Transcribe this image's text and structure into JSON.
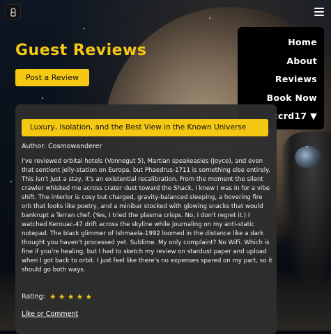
{
  "header": {
    "logo_icon": "astronaut-logo-icon",
    "menu_icon": "hamburger-menu-icon"
  },
  "menu": {
    "items": [
      "Home",
      "About",
      "Reviews",
      "Book Now",
      "ccrd17 ▼"
    ]
  },
  "page": {
    "title": "Guest Reviews",
    "post_button": "Post a Review"
  },
  "review": {
    "title": "Luxury, Isolation, and the Best View in the Known Universe",
    "author": "Author: Cosmowanderer",
    "body": "I've reviewed orbital hotels (Vonnegut 5), Martian speakeasies (Joyce), and even that sentient jelly-station on Europa, but Phaedrus-1711 is something else entirely. This isn't just a stay, it's an existential recalibration. From the moment the silent crawler whisked me across crater dust toward the Shack, I knew I was in for a vibe shift. The interior is cosy but charged, gravity-balanced sleeping, a hovering fire orb that looks like poetry, and a minibar stocked with glowing snacks that would bankrupt a Terran chef. (Yes, I tried the plasma crisps. No, I don't regret it.) I watched Kerouac-47 drift across the skyline while journaling on my anti-static notepad. The black glimmer of Ishmaela-1992 loomed in the distance like a dark thought you haven't processed yet. Sublime. My only complaint? No WiFi. Which is fine if you're healing, but I had to sketch my review on stardust paper and upload when I got back to orbit. I just feel like there's no expenses spared on my part, so it should go both ways.",
    "rating_label": "Rating:",
    "rating_value": 5,
    "rating_max": 5,
    "like_link": "Like or Comment"
  },
  "colors": {
    "accent": "#f5c814",
    "card_bg": "#2e2e2e",
    "menu_bg": "#000000"
  }
}
